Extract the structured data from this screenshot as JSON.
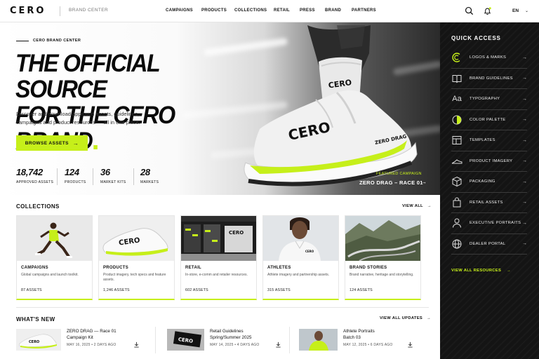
{
  "header": {
    "logo": "CERO",
    "brand_center": "BRAND CENTER",
    "nav": [
      "CAMPAIGNS",
      "PRODUCTS",
      "COLLECTIONS",
      "RETAIL",
      "PRESS",
      "BRAND",
      "PARTNERS"
    ],
    "language": "EN"
  },
  "hero": {
    "eyebrow": "CERO BRAND CENTER",
    "title_line1": "THE OFFICIAL SOURCE",
    "title_line2": "FOR THE CERO BRAND",
    "description": "Discover and download approved assets, guidelines, campaigns and product resources — all in one place.",
    "cta": "BROWSE ASSETS",
    "stats": [
      {
        "value": "18,742",
        "label": "APPROVED ASSETS"
      },
      {
        "value": "124",
        "label": "PRODUCTS"
      },
      {
        "value": "36",
        "label": "MARKET KITS"
      },
      {
        "value": "28",
        "label": "MARKETS"
      }
    ],
    "featured_label": "FEATURED CAMPAIGN",
    "featured_name": "ZERO DRAG – RACE 01",
    "shoe_brand": "CERO",
    "shoe_model": "ZERO DRAG",
    "sock_brand": "CERO"
  },
  "quick_access": {
    "title": "QUICK ACCESS",
    "items": [
      {
        "label": "LOGOS & MARKS",
        "icon": "logo-mark-icon"
      },
      {
        "label": "BRAND GUIDELINES",
        "icon": "book-icon"
      },
      {
        "label": "TYPOGRAPHY",
        "icon": "typography-icon",
        "glyph": "Aa"
      },
      {
        "label": "COLOR PALETTE",
        "icon": "color-palette-icon"
      },
      {
        "label": "TEMPLATES",
        "icon": "templates-icon"
      },
      {
        "label": "PRODUCT IMAGERY",
        "icon": "shoe-icon"
      },
      {
        "label": "PACKAGING",
        "icon": "box-icon"
      },
      {
        "label": "RETAIL ASSETS",
        "icon": "shopping-bag-icon"
      },
      {
        "label": "EXECUTIVE PORTRAITS",
        "icon": "person-icon"
      },
      {
        "label": "DEALER PORTAL",
        "icon": "globe-icon"
      }
    ],
    "view_all": "VIEW ALL RESOURCES"
  },
  "collections": {
    "title": "COLLECTIONS",
    "view_all": "VIEW ALL",
    "cards": [
      {
        "title": "CAMPAIGNS",
        "desc": "Global campaigns and launch toolkit.",
        "count": "87 ASSETS"
      },
      {
        "title": "PRODUCTS",
        "desc": "Product imagery, tech specs and feature assets.",
        "count": "1,246 ASSETS"
      },
      {
        "title": "RETAIL",
        "desc": "In-store, e-comm and retailer resources.",
        "count": "602 ASSETS"
      },
      {
        "title": "ATHLETES",
        "desc": "Athlete imagery and partnership assets.",
        "count": "315 ASSETS"
      },
      {
        "title": "BRAND STORIES",
        "desc": "Brand narrative, heritage and storytelling.",
        "count": "124 ASSETS"
      }
    ],
    "shoe_text": "CERO",
    "retail_sign": "CERO",
    "athlete_shirt": "CERO"
  },
  "whats_new": {
    "title": "WHAT'S NEW",
    "view_all": "VIEW ALL UPDATES",
    "items": [
      {
        "line1": "ZERO DRAG — Race 01",
        "line2": "Campaign Kit",
        "date": "MAY 16, 2025",
        "ago": "2 DAYS AGO"
      },
      {
        "line1": "Retail Guidelines",
        "line2": "Spring/Summer 2025",
        "date": "MAY 14, 2025",
        "ago": "4 DAYS AGO"
      },
      {
        "line1": "Athlete Portraits",
        "line2": "Batch 03",
        "date": "MAY 12, 2025",
        "ago": "6 DAYS AGO"
      }
    ],
    "thumb_text": [
      "CERO",
      "CERO"
    ]
  },
  "colors": {
    "accent": "#c6ef1a",
    "dark": "#141414"
  }
}
